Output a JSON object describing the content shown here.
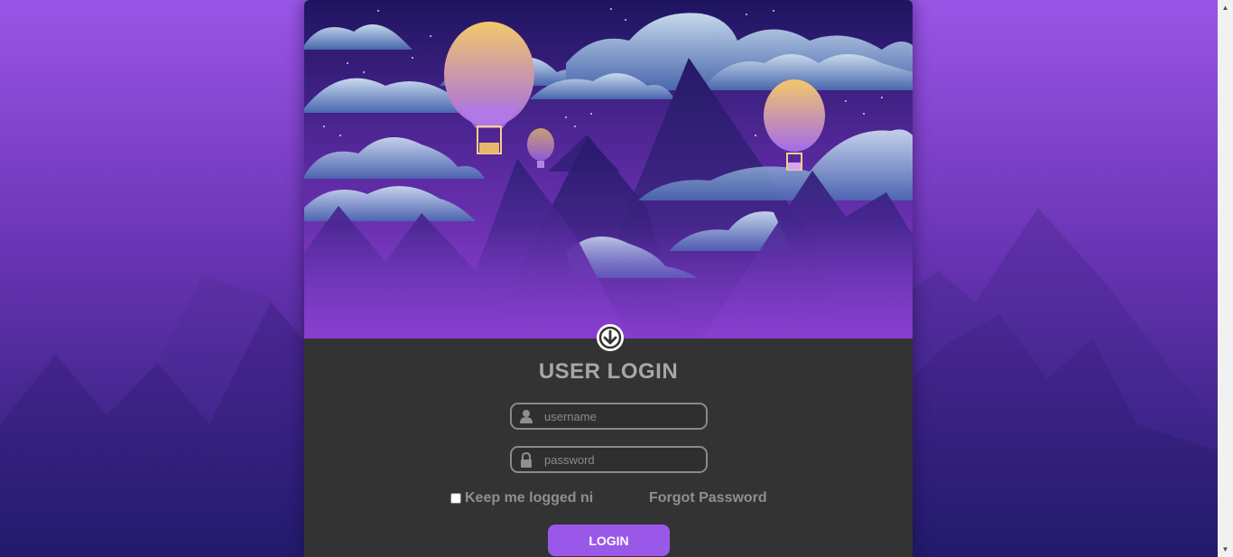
{
  "login": {
    "title": "USER LOGIN",
    "username_placeholder": "username",
    "password_placeholder": "password",
    "remember_label": "Keep me logged ni",
    "forgot_label": "Forgot Password",
    "button_label": "LOGIN"
  },
  "icons": {
    "user": "user-icon",
    "lock": "lock-icon",
    "down": "arrow-down-circle-icon"
  },
  "colors": {
    "background_top": "#9a55e6",
    "background_bottom": "#1f1a66",
    "panel": "#333333",
    "accent": "#9a58e8",
    "text_muted": "#a7a7a7"
  }
}
